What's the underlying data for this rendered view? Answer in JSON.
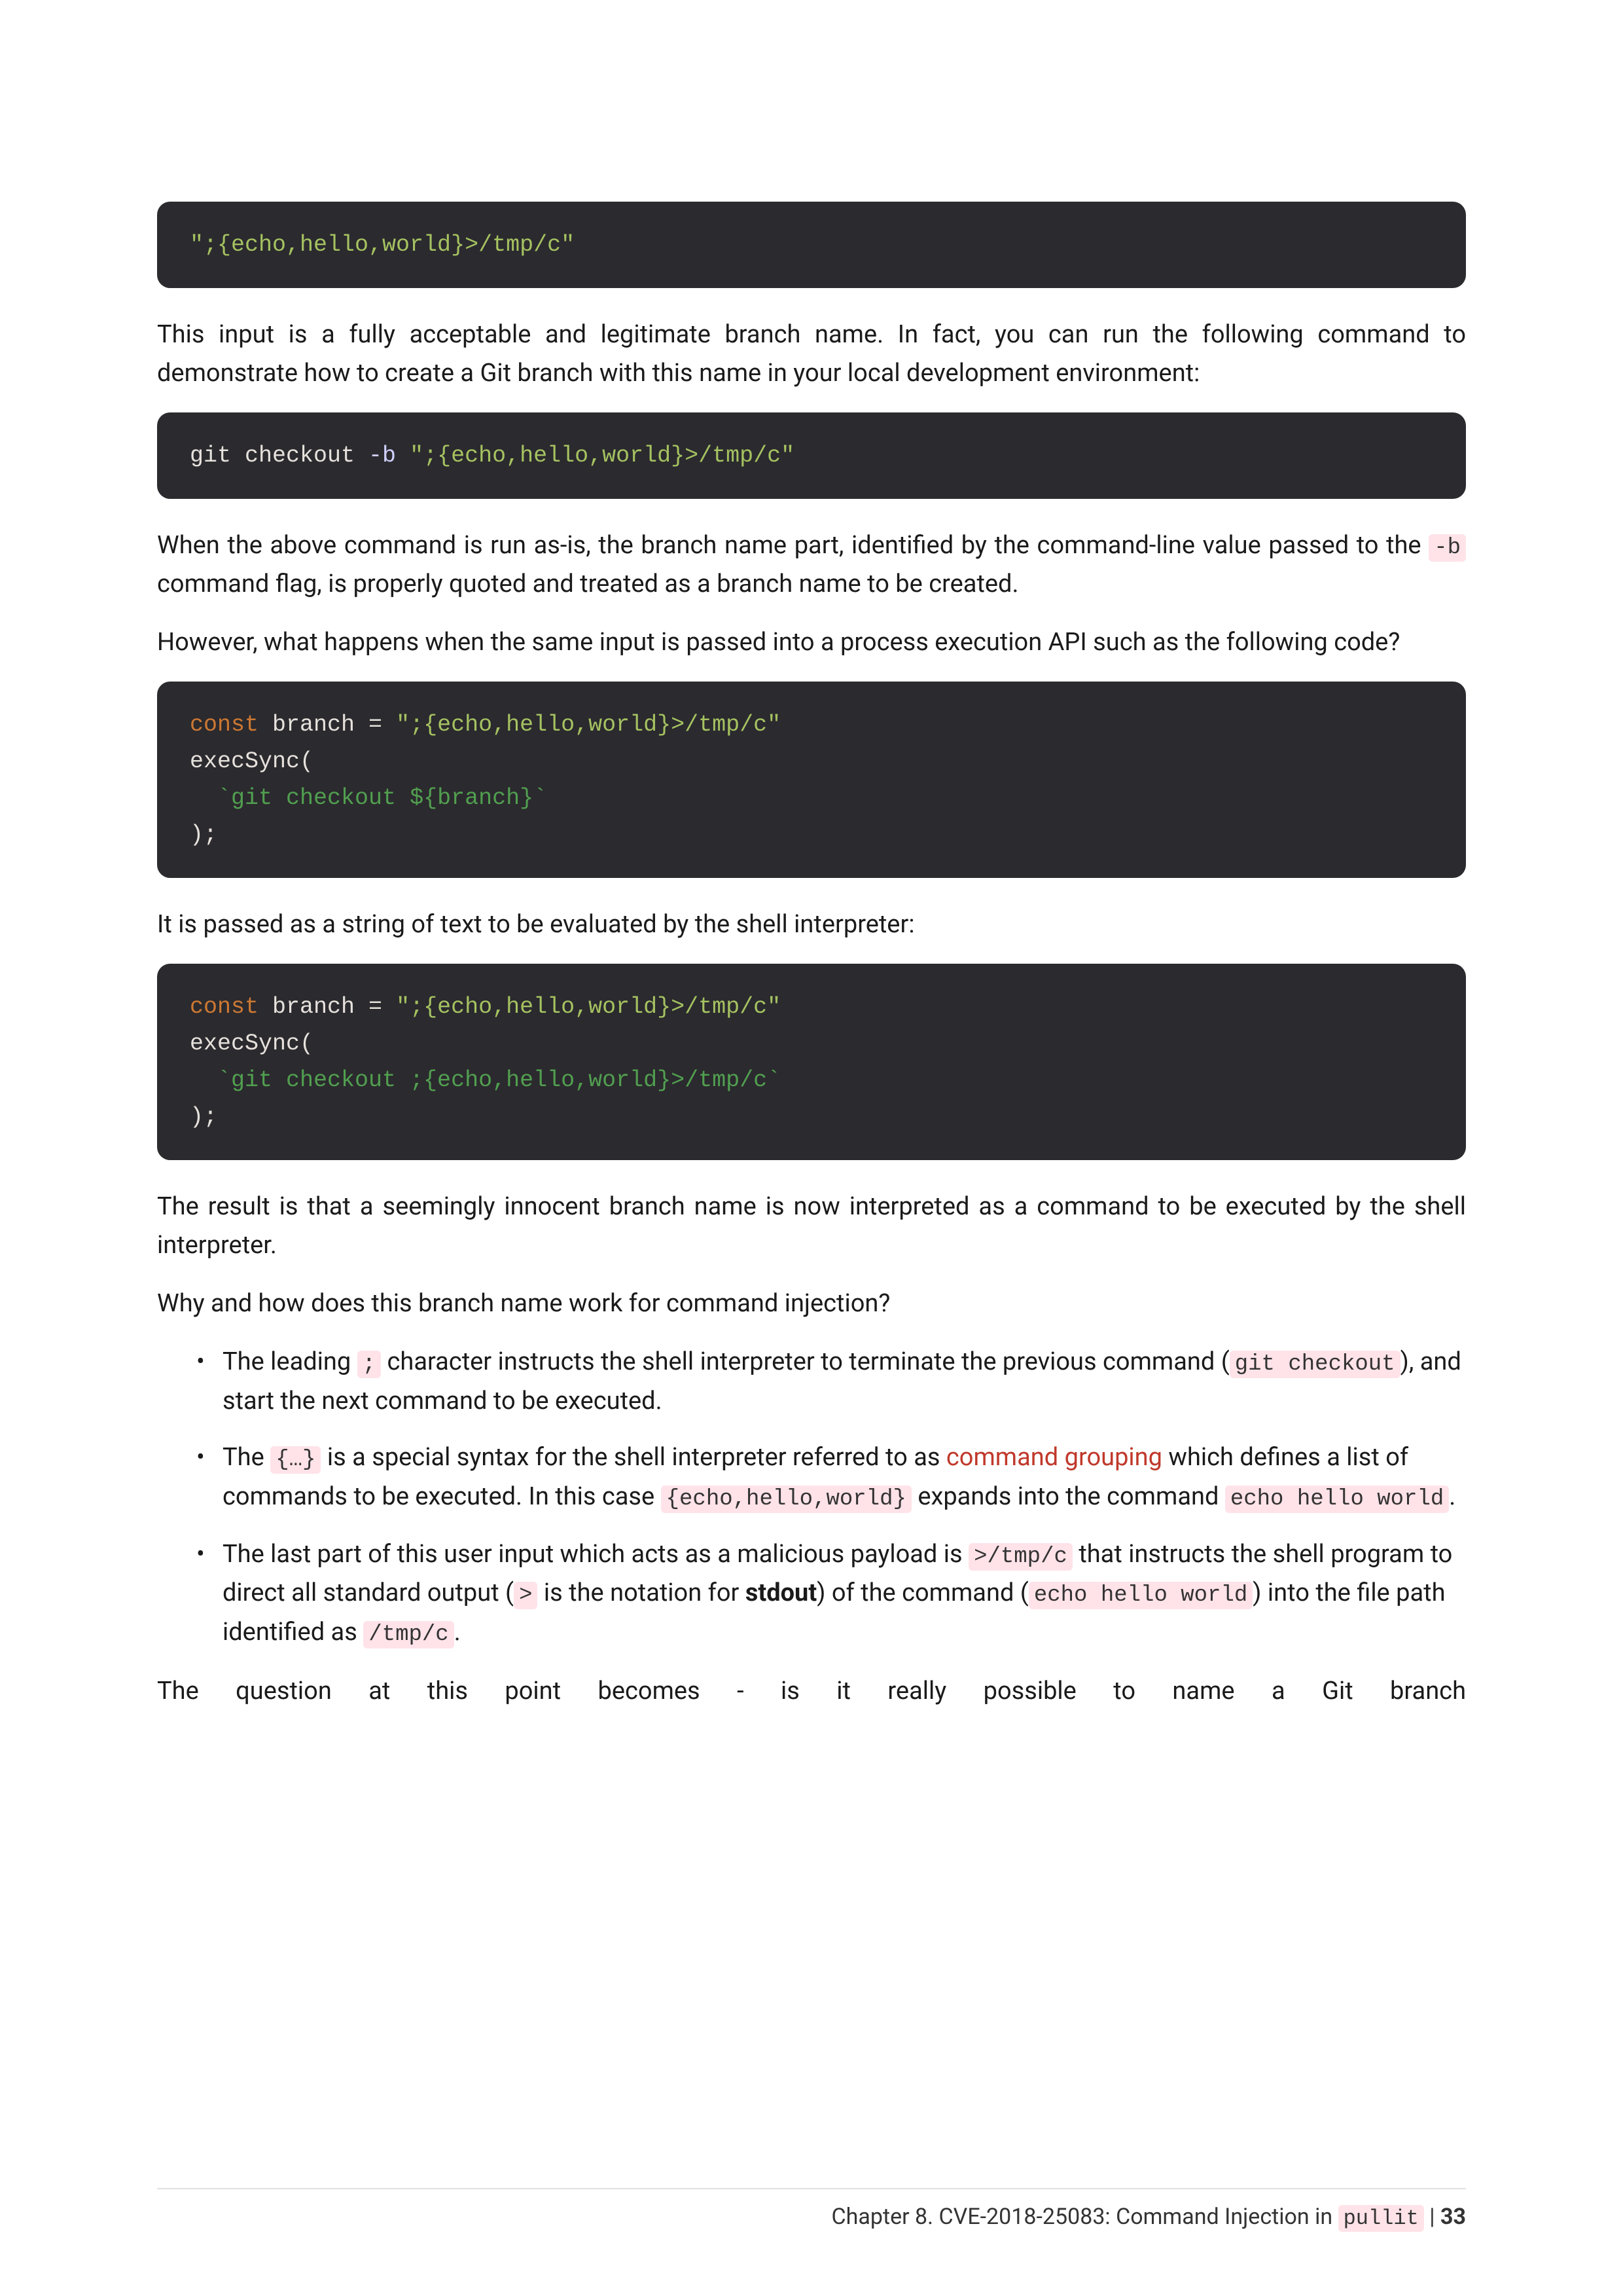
{
  "code1": "\";{echo,hello,world}>/tmp/c\"",
  "para1": "This input is a fully acceptable and legitimate branch name. In fact, you can run the following command to demonstrate how to create a Git branch with this name in your local development environment:",
  "code2": {
    "prefix": "git checkout ",
    "flag": "-b",
    "rest": " \";{echo,hello,world}>/tmp/c\""
  },
  "para2_a": "When the above command is run as-is, the branch name part, identified by the command-line value passed to the ",
  "para2_code": "-b",
  "para2_b": " command flag, is properly quoted and treated as a branch name to be created.",
  "para3": "However, what happens when the same input is passed into a process execution API such as the following code?",
  "code3": {
    "l1_kw": "const",
    "l1_var": " branch = ",
    "l1_str": "\";{echo,hello,world}>/tmp/c\"",
    "l2": "execSync(",
    "l3_a": "  `git checkout ",
    "l3_b": "${branch}",
    "l3_c": "`",
    "l4": ");"
  },
  "para4": "It is passed as a string of text to be evaluated by the shell interpreter:",
  "code4": {
    "l1_kw": "const",
    "l1_var": " branch = ",
    "l1_str": "\";{echo,hello,world}>/tmp/c\"",
    "l2": "execSync(",
    "l3": "  `git checkout ;{echo,hello,world}>/tmp/c`",
    "l4": ");"
  },
  "para5": "The result is that a seemingly innocent branch name is now interpreted as a command to be executed by the shell interpreter.",
  "para6": "Why and how does this branch name work for command injection?",
  "bullets": {
    "b1_a": "The leading ",
    "b1_c1": ";",
    "b1_b": " character instructs the shell interpreter to terminate the previous command (",
    "b1_c2": "git checkout",
    "b1_c": "), and start the next command to be executed.",
    "b2_a": "The ",
    "b2_c1": "{…}",
    "b2_b": " is a special syntax for the shell interpreter referred to as ",
    "b2_link": "command grouping",
    "b2_c": " which defines a list of commands to be executed. In this case ",
    "b2_c2": "{echo,hello,world}",
    "b2_d": " expands into the command ",
    "b2_c3": "echo hello world",
    "b2_e": ".",
    "b3_a": "The last part of this user input which acts as a malicious payload is ",
    "b3_c1": ">/tmp/c",
    "b3_b": " that instructs the shell program to direct all standard output (",
    "b3_c2": ">",
    "b3_c": " is the notation for ",
    "b3_strong": "stdout",
    "b3_d": ") of the command (",
    "b3_c3": "echo hello world",
    "b3_e": ") into the file path identified as ",
    "b3_c4": "/tmp/c",
    "b3_f": "."
  },
  "para7": "The  question  at  this  point  becomes  -  is  it  really  possible  to  name  a  Git  branch",
  "footer": {
    "chapter": "Chapter 8. CVE-2018-25083: Command Injection in ",
    "pkg": "pullit",
    "sep": " | ",
    "page": "33"
  }
}
